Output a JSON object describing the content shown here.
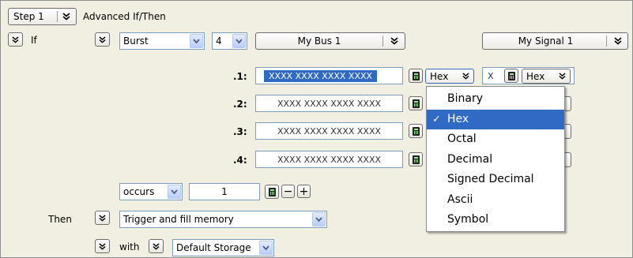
{
  "header": {
    "step_label": "Step 1",
    "title": "Advanced If/Then"
  },
  "if_row": {
    "label": "If",
    "mode_value": "Burst",
    "count_value": "4",
    "bus_label": "My Bus 1",
    "signal_label": "My Signal 1"
  },
  "bursts": [
    {
      "label": ".1:",
      "value": "XXXX XXXX XXXX XXXX",
      "format": "Hex",
      "signal_value": "X",
      "signal_format": "Hex"
    },
    {
      "label": ".2:",
      "value": "XXXX XXXX XXXX XXXX"
    },
    {
      "label": ".3:",
      "value": "XXXX XXXX XXXX XXXX"
    },
    {
      "label": ".4:",
      "value": "XXXX XXXX XXXX XXXX"
    }
  ],
  "format_menu": {
    "items": [
      "Binary",
      "Hex",
      "Octal",
      "Decimal",
      "Signed Decimal",
      "Ascii",
      "Symbol"
    ],
    "selected": "Hex",
    "check": "✓"
  },
  "occurs": {
    "mode": "occurs",
    "count": "1",
    "minus": "−",
    "plus": "+"
  },
  "then_row": {
    "label": "Then",
    "action": "Trigger and fill memory"
  },
  "with_row": {
    "label": "with",
    "storage": "Default Storage"
  },
  "colors": {
    "panel_bg": "#f1efe2",
    "selection": "#316ac5",
    "field_border": "#7f9db9"
  }
}
